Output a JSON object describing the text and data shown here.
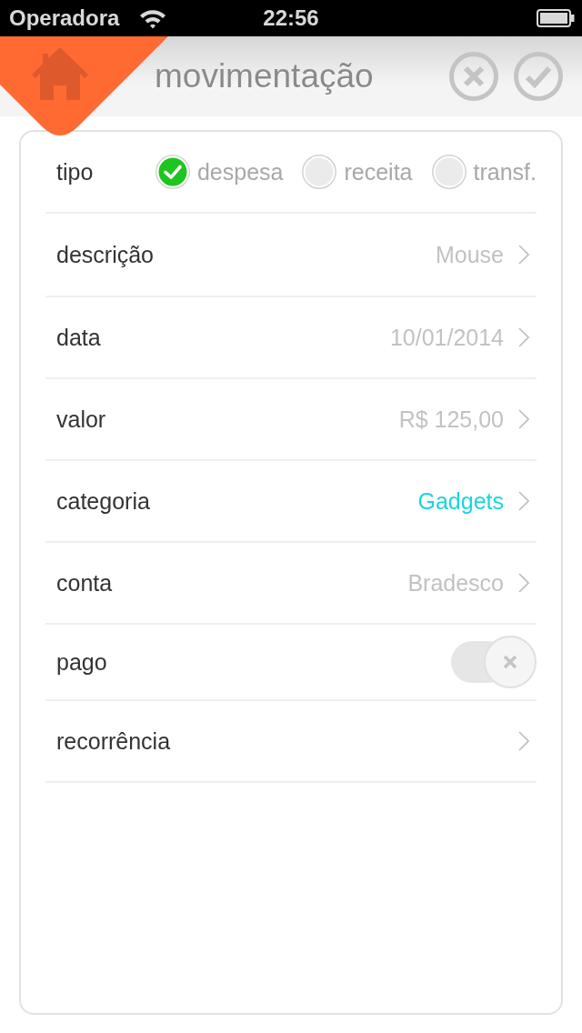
{
  "status_bar": {
    "carrier": "Operadora",
    "time": "22:56"
  },
  "header": {
    "title": "movimentação"
  },
  "type_row": {
    "label": "tipo",
    "options": [
      {
        "label": "despesa",
        "selected": true
      },
      {
        "label": "receita",
        "selected": false
      },
      {
        "label": "transf.",
        "selected": false
      }
    ]
  },
  "rows": [
    {
      "kind": "link",
      "label": "descrição",
      "value": "Mouse",
      "highlighted": false
    },
    {
      "kind": "link",
      "label": "data",
      "value": "10/01/2014",
      "highlighted": false
    },
    {
      "kind": "link",
      "label": "valor",
      "value": "R$ 125,00",
      "highlighted": false
    },
    {
      "kind": "link",
      "label": "categoria",
      "value": "Gadgets",
      "highlighted": true
    },
    {
      "kind": "link",
      "label": "conta",
      "value": "Bradesco",
      "highlighted": false
    },
    {
      "kind": "toggle",
      "label": "pago",
      "on": false
    },
    {
      "kind": "link",
      "label": "recorrência"
    }
  ]
}
